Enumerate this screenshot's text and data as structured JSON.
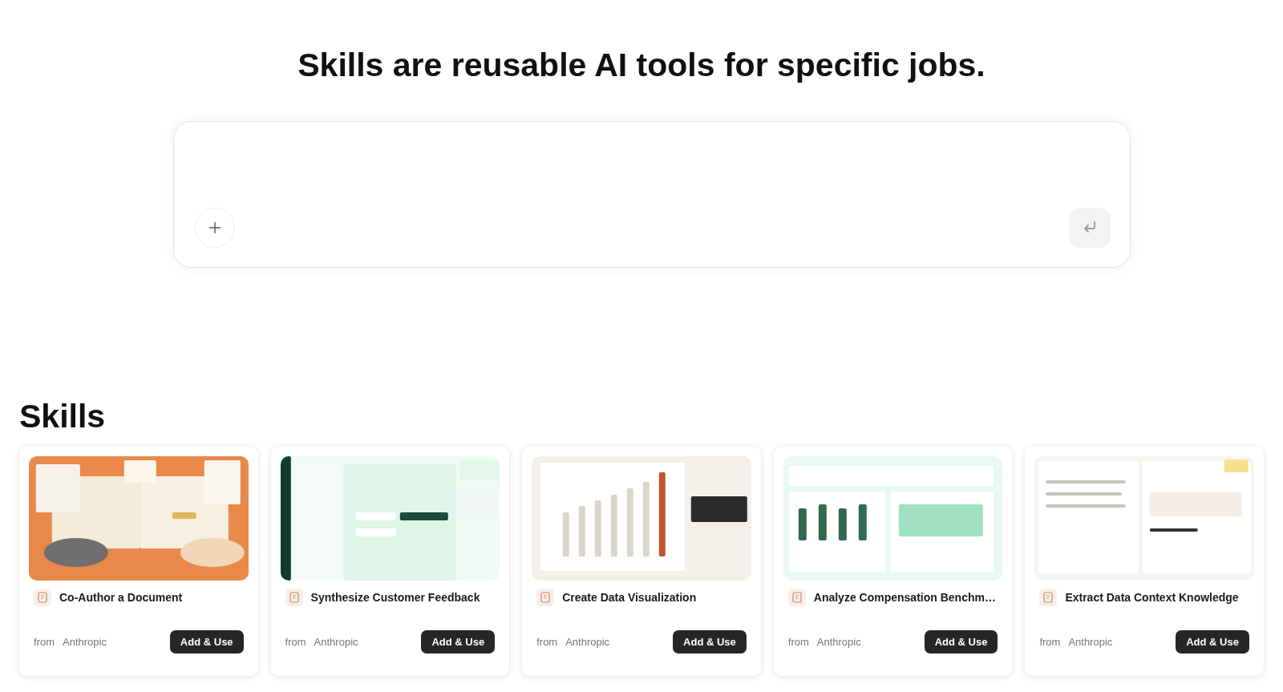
{
  "headline": "Skills are reusable AI tools for specific jobs.",
  "skills_section": {
    "title": "Skills",
    "cards": [
      {
        "title": "Co-Author a Document",
        "from_label": "from",
        "author": "Anthropic",
        "button": "Add & Use"
      },
      {
        "title": "Synthesize Customer Feedback",
        "from_label": "from",
        "author": "Anthropic",
        "button": "Add & Use"
      },
      {
        "title": "Create Data Visualization",
        "from_label": "from",
        "author": "Anthropic",
        "button": "Add & Use"
      },
      {
        "title": "Analyze Compensation Benchm…",
        "from_label": "from",
        "author": "Anthropic",
        "button": "Add & Use"
      },
      {
        "title": "Extract Data Context Knowledge",
        "from_label": "from",
        "author": "Anthropic",
        "button": "Add & Use"
      }
    ]
  }
}
